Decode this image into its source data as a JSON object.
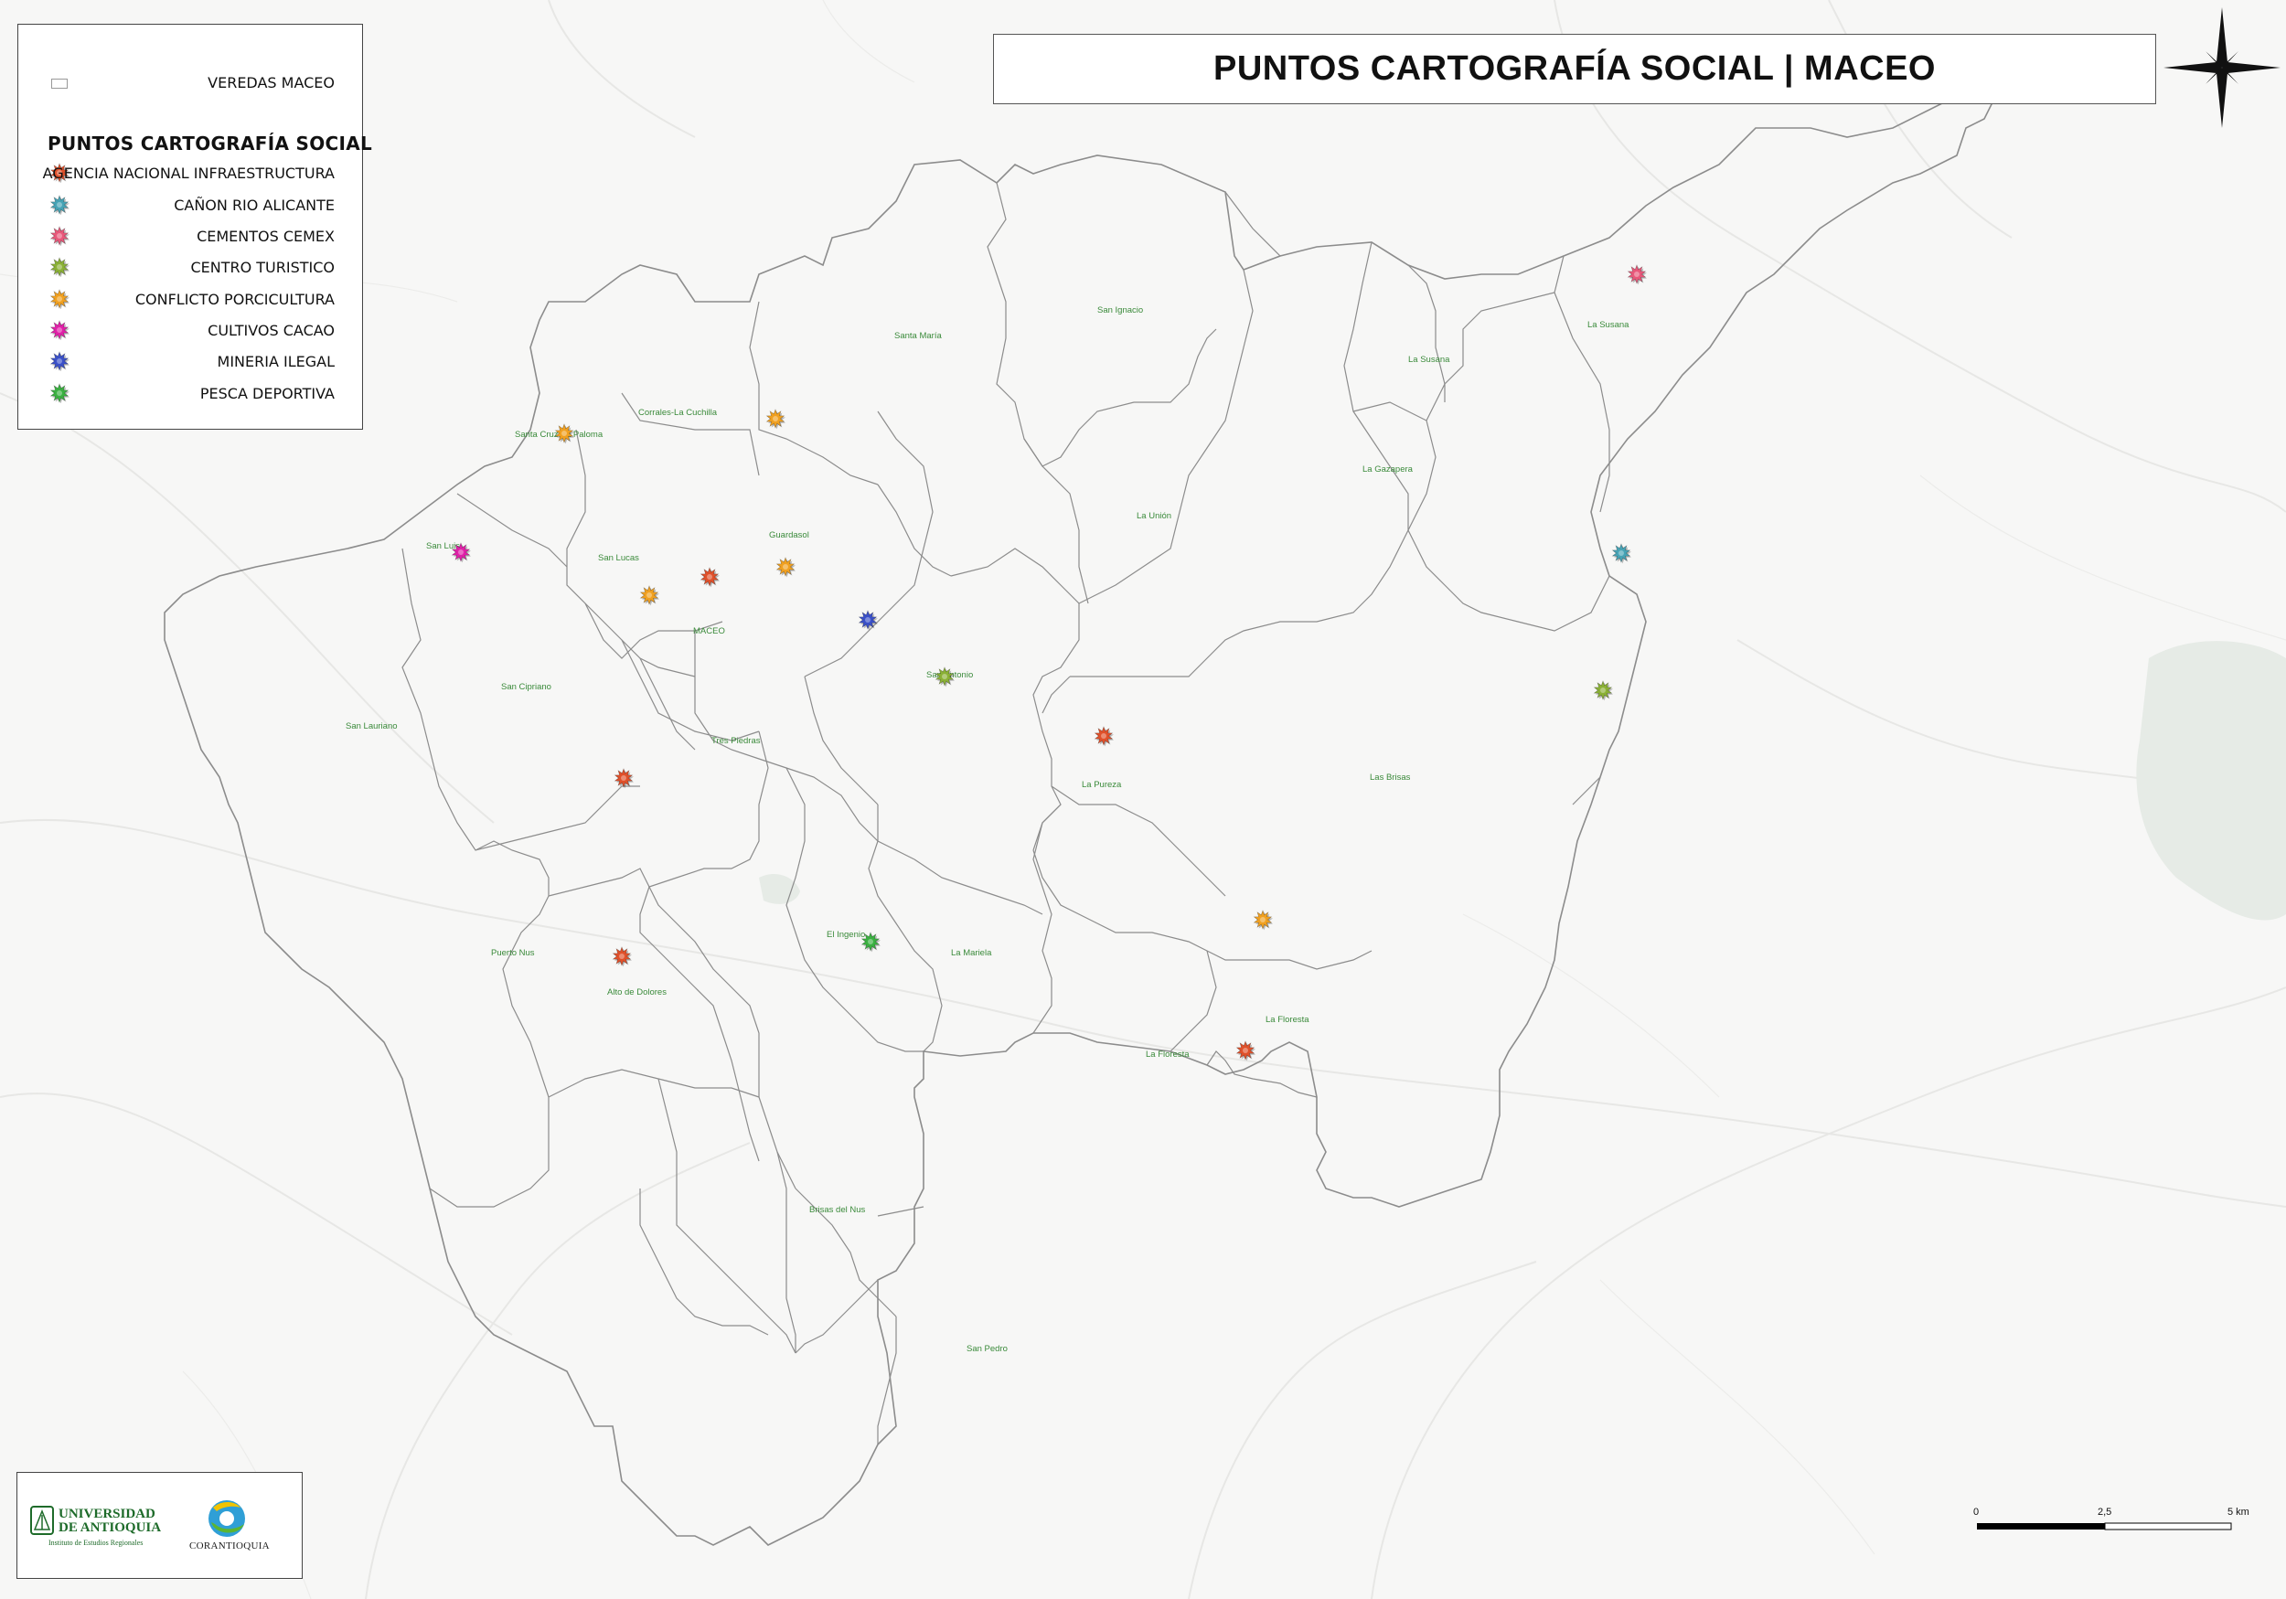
{
  "title": "PUNTOS CARTOGRAFÍA SOCIAL | MACEO",
  "legend": {
    "veredas_label": "VEREDAS MACEO",
    "heading": "PUNTOS CARTOGRAFÍA SOCIAL",
    "items": [
      {
        "label": "AGENCIA NACIONAL INFRAESTRUCTURA",
        "color": "#e0502a"
      },
      {
        "label": "CAÑON RIO ALICANTE",
        "color": "#46a3b5"
      },
      {
        "label": "CEMENTOS CEMEX",
        "color": "#e8587a"
      },
      {
        "label": "CENTRO TURISTICO",
        "color": "#8ab035"
      },
      {
        "label": "CONFLICTO PORCICULTURA",
        "color": "#f0a020"
      },
      {
        "label": "CULTIVOS CACAO",
        "color": "#e020a8"
      },
      {
        "label": "MINERIA ILEGAL",
        "color": "#3a50c8"
      },
      {
        "label": "PESCA DEPORTIVA",
        "color": "#3ab040"
      }
    ]
  },
  "veredas": [
    "Santa María",
    "San Ignacio",
    "La Susana",
    "La Susana",
    "Corrales-La Cuchilla",
    "Santa Cruz-La Paloma",
    "La Gazapera",
    "La Unión",
    "Guardasol",
    "San Luis",
    "San Lucas",
    "MACEO",
    "San Antonio",
    "San Cipriano",
    "San Lauriano",
    "Tres Piedras",
    "La Pureza",
    "Las Brisas",
    "El Ingenio",
    "La Mariela",
    "Puerto Nus",
    "Alto de Dolores",
    "La Floresta",
    "La Floresta",
    "Brisas del Nus",
    "San Pedro"
  ],
  "scale": {
    "labels": [
      "0",
      "2,5",
      "5 km"
    ]
  },
  "logos": {
    "university_line1": "UNIVERSIDAD",
    "university_line2": "DE ANTIOQUIA",
    "university_sub": "Instituto de Estudios Regionales",
    "corantioquia": "CORANTIOQUIA"
  }
}
